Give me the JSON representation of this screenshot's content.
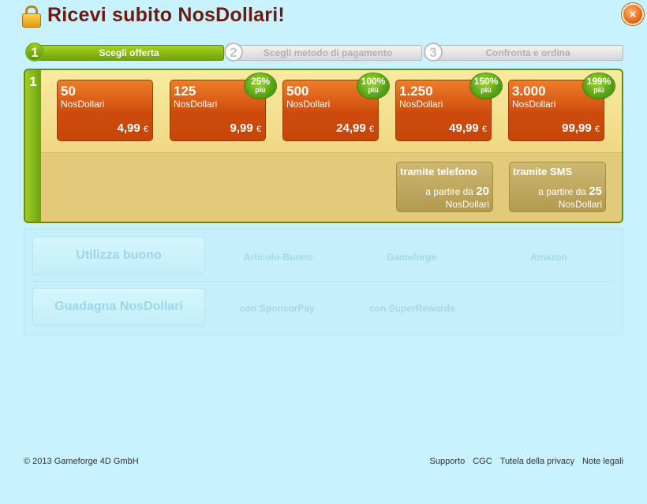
{
  "header": {
    "title": "Ricevi subito NosDollari!"
  },
  "close_label": "×",
  "steps": [
    {
      "num": "1",
      "label": "Scegli offerta"
    },
    {
      "num": "2",
      "label": "Scegli metodo di pagamento"
    },
    {
      "num": "3",
      "label": "Confronta e ordina"
    }
  ],
  "panel_num": "1",
  "packages": [
    {
      "amount": "50",
      "unit": "NosDollari",
      "price": "4,99",
      "currency": "€",
      "badge_pct": "",
      "badge_more": ""
    },
    {
      "amount": "125",
      "unit": "NosDollari",
      "price": "9,99",
      "currency": "€",
      "badge_pct": "25%",
      "badge_more": "più"
    },
    {
      "amount": "500",
      "unit": "NosDollari",
      "price": "24,99",
      "currency": "€",
      "badge_pct": "100%",
      "badge_more": "più"
    },
    {
      "amount": "1.250",
      "unit": "NosDollari",
      "price": "49,99",
      "currency": "€",
      "badge_pct": "150%",
      "badge_more": "più"
    },
    {
      "amount": "3.000",
      "unit": "NosDollari",
      "price": "99,99",
      "currency": "€",
      "badge_pct": "199%",
      "badge_more": "più"
    }
  ],
  "alt_methods": [
    {
      "title": "tramite telefono",
      "from": "a partire da",
      "value": "20",
      "unit": "NosDollari"
    },
    {
      "title": "tramite SMS",
      "from": "a partire da",
      "value": "25",
      "unit": "NosDollari"
    }
  ],
  "voucher": {
    "button": "Utilizza buono",
    "links": [
      "Articolo-Buono",
      "Gameforge",
      "Amazon"
    ]
  },
  "earn": {
    "button": "Guadagna NosDollari",
    "links": [
      "con SponsorPay",
      "con SuperRewards"
    ]
  },
  "footer": {
    "copyright": "© 2013 Gameforge 4D GmbH",
    "links": [
      "Supporto",
      "CGC",
      "Tutela della privacy",
      "Note legali"
    ]
  },
  "colors": {
    "background": "#c8f2fd",
    "title": "#6e1a10",
    "accent_green": "#7ab70f",
    "package_orange": "#cd4b0c"
  }
}
